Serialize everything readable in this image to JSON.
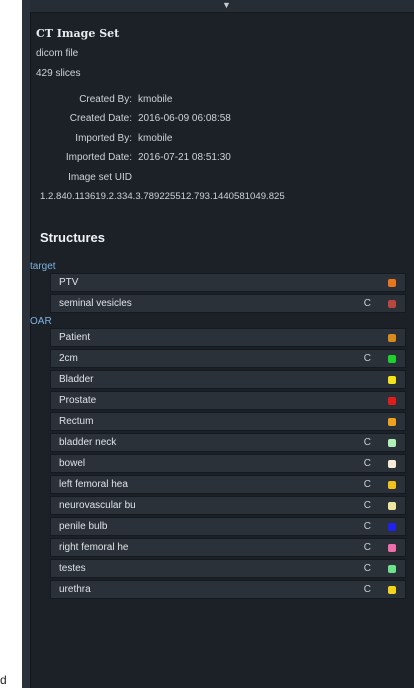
{
  "edge_text": "d",
  "collapse_arrow": "▼",
  "image_set": {
    "title": "CT Image Set",
    "type": "dicom file",
    "slices": "429 slices",
    "meta": [
      {
        "label": "Created By:",
        "value": "kmobile"
      },
      {
        "label": "Created Date:",
        "value": "2016-06-09 06:08:58"
      },
      {
        "label": "Imported By:",
        "value": "kmobile"
      },
      {
        "label": "Imported Date:",
        "value": "2016-07-21 08:51:30"
      },
      {
        "label": "Image set UID",
        "value": ""
      }
    ],
    "uid": "1.2.840.113619.2.334.3.789225512.793.1440581049.825"
  },
  "structures": {
    "heading": "Structures",
    "groups": [
      {
        "label": "target",
        "items": [
          {
            "name": "PTV",
            "c": "",
            "color": "#e8761c"
          },
          {
            "name": "seminal vesicles",
            "c": "C",
            "color": "#b8463e"
          }
        ]
      },
      {
        "label": "OAR",
        "items": [
          {
            "name": "Patient",
            "c": "",
            "color": "#d88a1c"
          },
          {
            "name": "2cm",
            "c": "C",
            "color": "#1ed22e"
          },
          {
            "name": "Bladder",
            "c": "",
            "color": "#f1e21a"
          },
          {
            "name": "Prostate",
            "c": "",
            "color": "#e21c1c"
          },
          {
            "name": "Rectum",
            "c": "",
            "color": "#f1a21c"
          },
          {
            "name": "bladder neck",
            "c": "C",
            "color": "#aef0b8"
          },
          {
            "name": "bowel",
            "c": "C",
            "color": "#f4ecd8"
          },
          {
            "name": "left femoral hea",
            "c": "C",
            "color": "#f1c21c"
          },
          {
            "name": "neurovascular bu",
            "c": "C",
            "color": "#eee6a0"
          },
          {
            "name": "penile bulb",
            "c": "C",
            "color": "#1e22f0"
          },
          {
            "name": "right femoral he",
            "c": "C",
            "color": "#f06ea8"
          },
          {
            "name": "testes",
            "c": "C",
            "color": "#6ee28a"
          },
          {
            "name": "urethra",
            "c": "C",
            "color": "#f1d41c"
          }
        ]
      }
    ]
  }
}
